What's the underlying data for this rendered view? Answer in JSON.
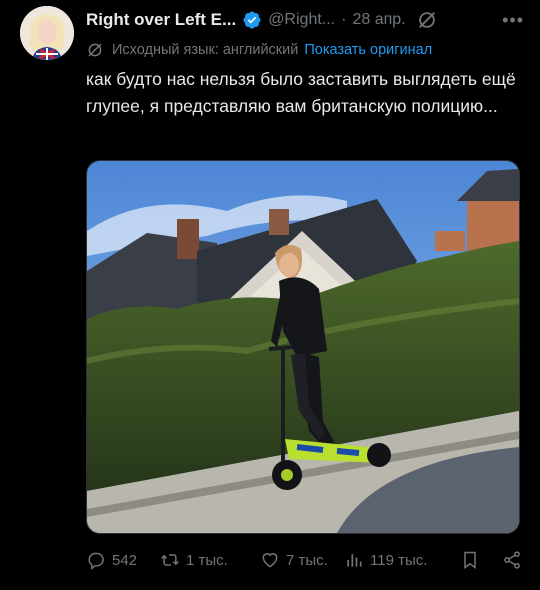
{
  "author": {
    "name": "Right over Left E...",
    "handle": "@Right...",
    "separator": "·",
    "date": "28 апр."
  },
  "translation": {
    "label": "Исходный язык: английский",
    "show_original": "Показать оригинал"
  },
  "tweet": {
    "text": "как будто нас нельзя было заставить выглядеть ещё глупее, я представляю вам британскую полицию..."
  },
  "actions": {
    "replies": "542",
    "retweets": "1 тыс.",
    "likes": "7 тыс.",
    "views": "119 тыс."
  },
  "icons": {
    "verified": "verified-badge-icon",
    "grok": "grok-icon",
    "more": "more-icon",
    "translate": "translate-icon",
    "reply": "reply-icon",
    "retweet": "retweet-icon",
    "like": "heart-icon",
    "views": "views-icon",
    "bookmark": "bookmark-icon",
    "share": "share-icon"
  },
  "colors": {
    "accent": "#1d9bf0",
    "muted": "#71767b",
    "text": "#e7e9ea",
    "background": "#000000"
  }
}
